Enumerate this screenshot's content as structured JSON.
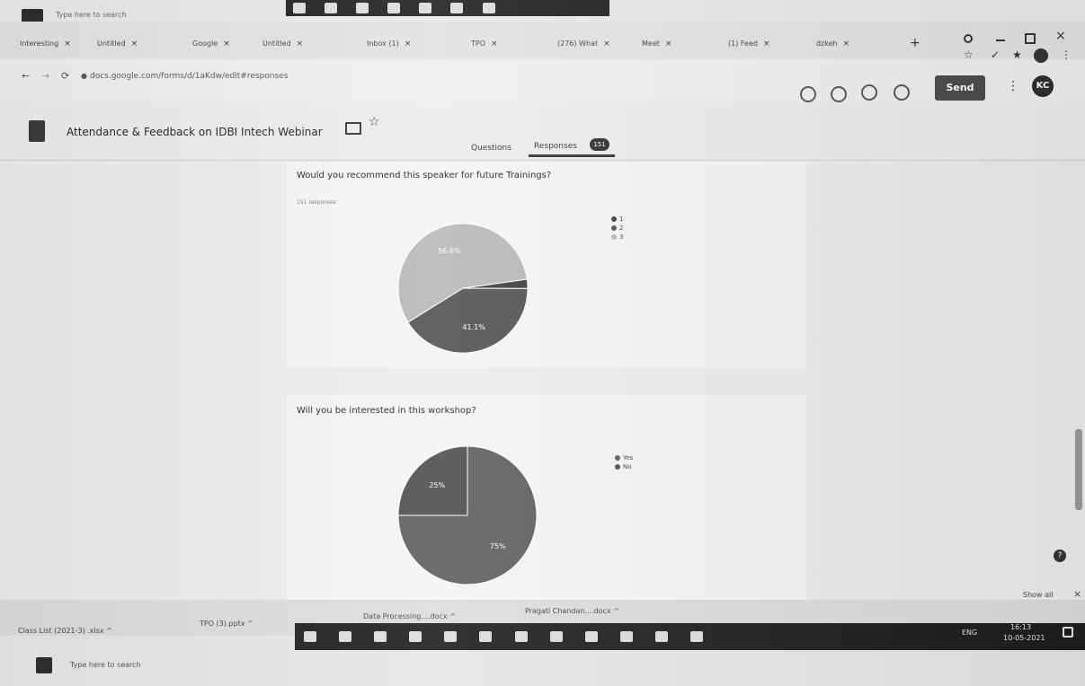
{
  "top": {
    "search_placeholder": "Type here to search"
  },
  "browser": {
    "tabs": [
      {
        "label": "Interesting"
      },
      {
        "label": "Untitled"
      },
      {
        "label": "Google"
      },
      {
        "label": "Untitled"
      },
      {
        "label": "Inbox (1)"
      },
      {
        "label": "TPO"
      },
      {
        "label": "(276) What"
      },
      {
        "label": "Meet"
      },
      {
        "label": "(1) Feed"
      },
      {
        "label": "dzkeh"
      }
    ],
    "url": "docs.google.com/forms/d/1aKdw/edit#responses",
    "new_tab": "+",
    "send_label": "Send",
    "avatar_initials": "KC"
  },
  "form": {
    "title": "Attendance & Feedback on IDBI Intech Webinar",
    "tabs": {
      "questions": "Questions",
      "responses": "Responses",
      "responses_count": "151"
    }
  },
  "chart_data": [
    {
      "type": "pie",
      "title": "Would you recommend this speaker for future Trainings?",
      "subtitle": "151 responses",
      "categories": [
        "1",
        "2",
        "3"
      ],
      "values": [
        2.3,
        41.1,
        56.6
      ],
      "labels": [
        "",
        "41.1%",
        "56.6%"
      ],
      "legend_position": "right",
      "colors": [
        "#3d3d3d",
        "#525252",
        "#b8b8b8"
      ]
    },
    {
      "type": "pie",
      "title": "Will you be interested in this workshop?",
      "subtitle": "",
      "categories": [
        "Yes",
        "No"
      ],
      "values": [
        75,
        25
      ],
      "labels": [
        "75%",
        "25%"
      ],
      "legend_position": "right",
      "colors": [
        "#5e5e5e",
        "#4e4e4e"
      ]
    }
  ],
  "downloads": {
    "items": [
      {
        "label": "Class List (2021-3) .xlsx"
      },
      {
        "label": "TPO (3).pptx"
      },
      {
        "label": "Data Processing....docx"
      },
      {
        "label": "Pragati Chandan....docx"
      }
    ],
    "show_all": "Show all",
    "close": "×"
  },
  "taskbar": {
    "search_placeholder": "Type here to search",
    "lang": "ENG",
    "time": "16:13",
    "date": "10-05-2021"
  }
}
